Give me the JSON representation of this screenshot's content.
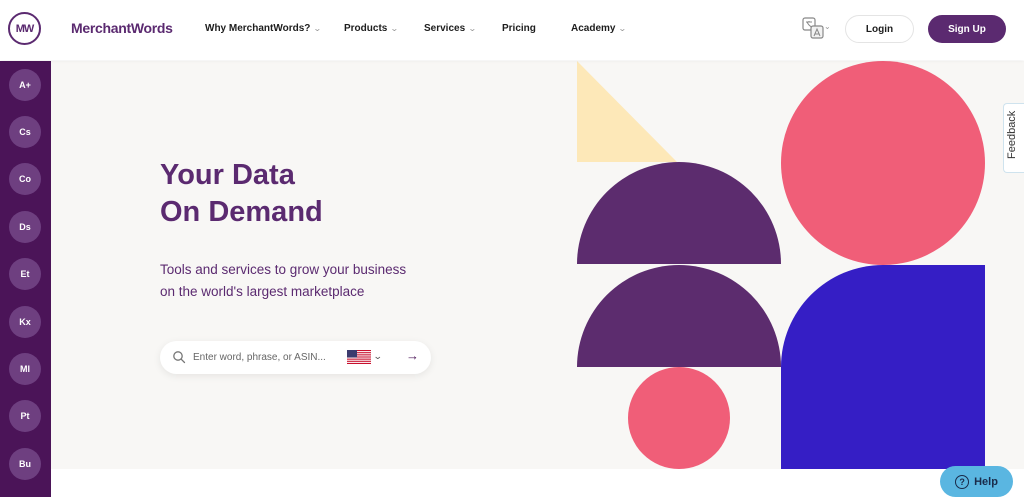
{
  "brand": {
    "logo_mark": "MW",
    "name": "MerchantWords"
  },
  "nav": {
    "items": [
      {
        "label": "Why MerchantWords?",
        "has_dropdown": true
      },
      {
        "label": "Products",
        "has_dropdown": true
      },
      {
        "label": "Services",
        "has_dropdown": true
      },
      {
        "label": "Pricing",
        "has_dropdown": false
      },
      {
        "label": "Academy",
        "has_dropdown": true
      }
    ],
    "language_icon": "translate-icon",
    "login_label": "Login",
    "signup_label": "Sign Up"
  },
  "sidebar": {
    "items": [
      "A+",
      "Cs",
      "Co",
      "Ds",
      "Et",
      "Kx",
      "Ml",
      "Pt",
      "Bu"
    ]
  },
  "hero": {
    "title_line1": "Your Data",
    "title_line2": "On Demand",
    "subtitle_line1": "Tools and services to grow your business",
    "subtitle_line2": "on the world's largest marketplace",
    "search_placeholder": "Enter word, phrase, or ASIN...",
    "marketplace_flag": "us-flag-icon",
    "submit_icon": "arrow-right-icon"
  },
  "feedback_label": "Feedback",
  "help_label": "Help",
  "colors": {
    "brand_purple": "#5b2a70",
    "sidebar_purple": "#4b1458",
    "shape_purple": "#5c2c6e",
    "shape_pink": "#f05e78",
    "shape_blue": "#351ec5",
    "shape_cream": "#fde8b8",
    "help_blue": "#5ab6e1"
  }
}
